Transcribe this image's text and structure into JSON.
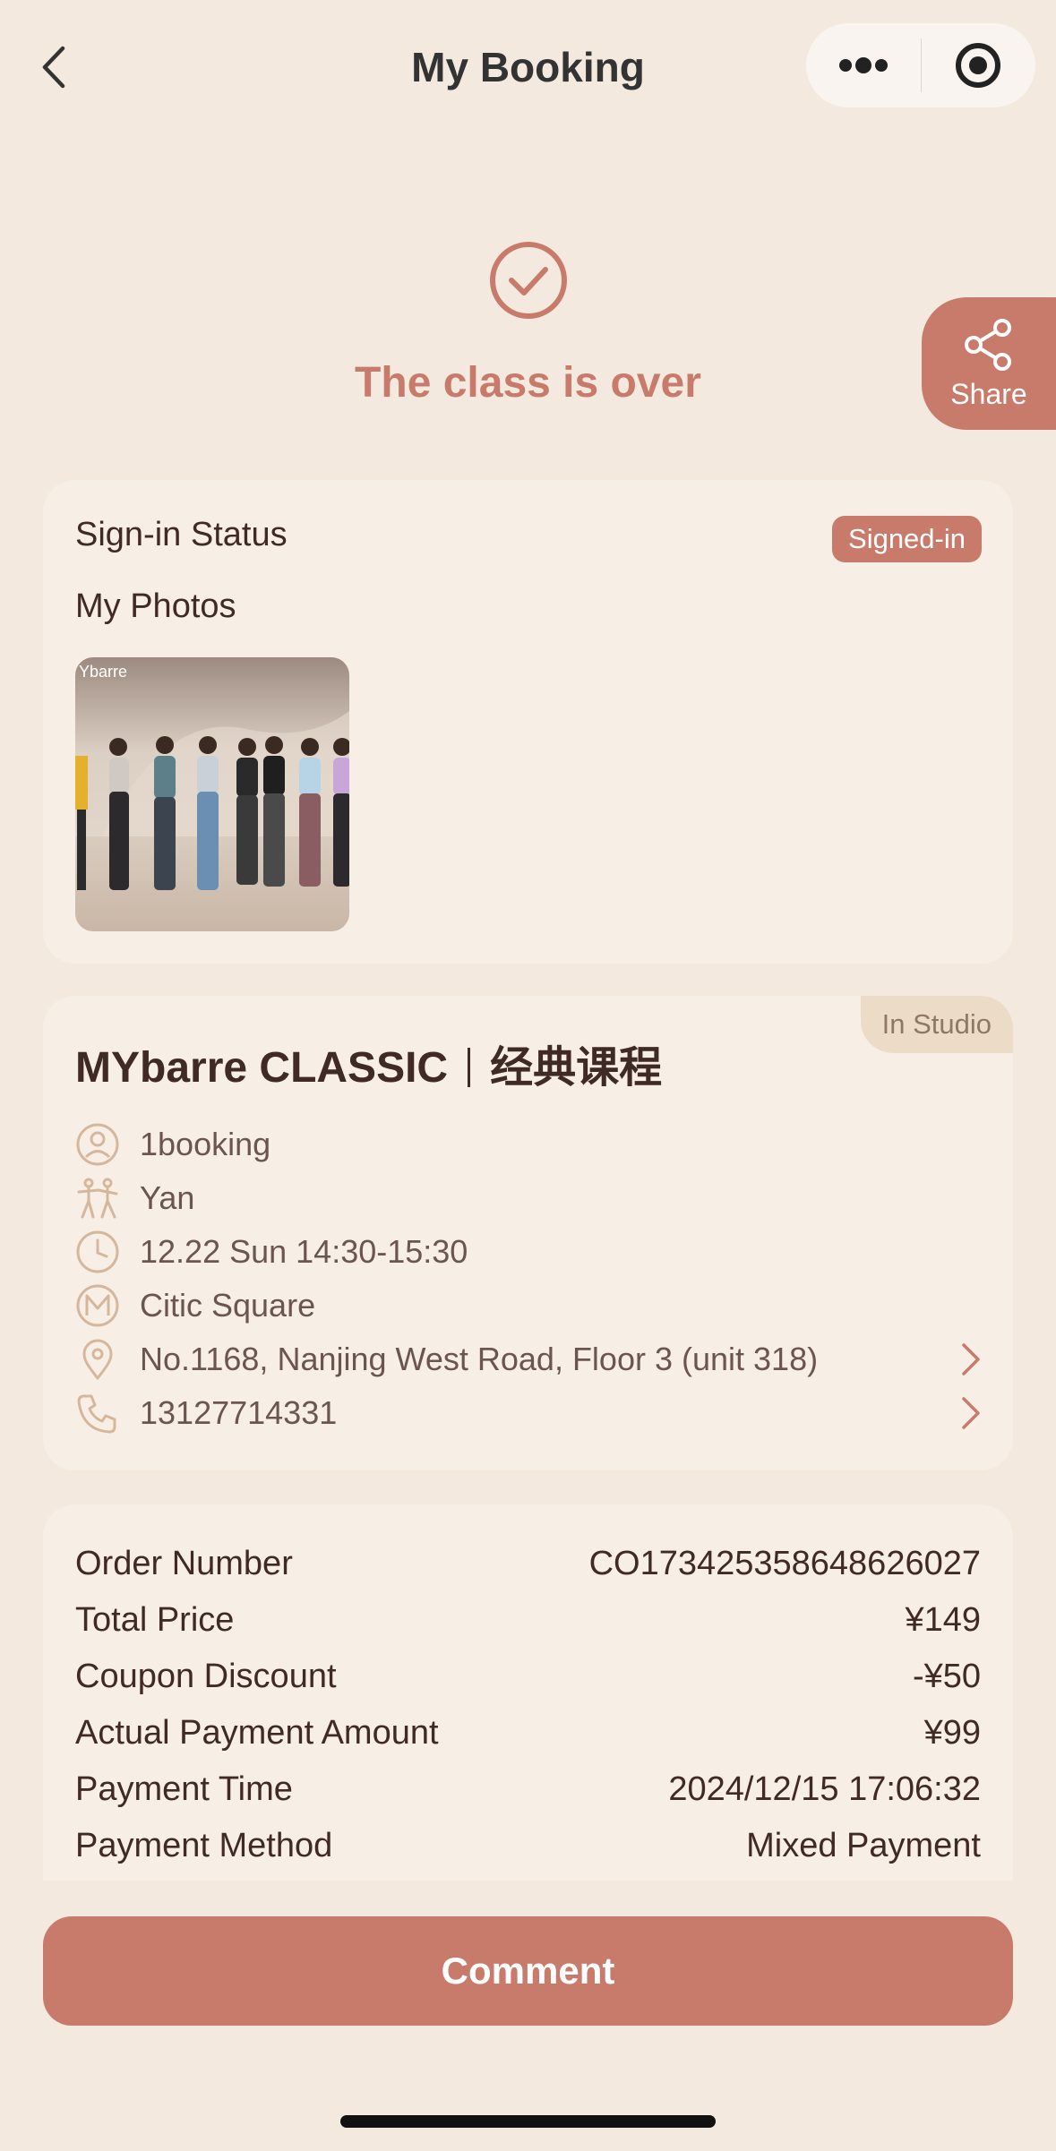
{
  "header": {
    "title": "My Booking"
  },
  "status": {
    "text": "The class is over"
  },
  "share": {
    "label": "Share"
  },
  "sign_in": {
    "label": "Sign-in Status",
    "badge": "Signed-in"
  },
  "photos": {
    "label": "My Photos",
    "watermark": "Ybarre"
  },
  "class_info": {
    "tag": "In Studio",
    "title_en": "MYbarre CLASSIC",
    "title_cn": "经典课程",
    "booking": "1booking",
    "instructor": "Yan",
    "time": "12.22 Sun 14:30-15:30",
    "studio": "Citic Square",
    "address": "No.1168, Nanjing West Road, Floor 3 (unit 318)",
    "phone": "13127714331"
  },
  "order": {
    "rows": [
      {
        "label": "Order Number",
        "value": "CO173425358648626027"
      },
      {
        "label": "Total Price",
        "value": "¥149"
      },
      {
        "label": "Coupon Discount",
        "value": "-¥50"
      },
      {
        "label": "Actual Payment Amount",
        "value": "¥99"
      },
      {
        "label": "Payment Time",
        "value": "2024/12/15 17:06:32"
      },
      {
        "label": "Payment Method",
        "value": "Mixed Payment"
      }
    ]
  },
  "actions": {
    "comment": "Comment"
  },
  "colors": {
    "accent": "#c97b6b",
    "background": "#f3e9de",
    "card": "#f7efe6",
    "tag_bg": "#ecdcc7"
  }
}
